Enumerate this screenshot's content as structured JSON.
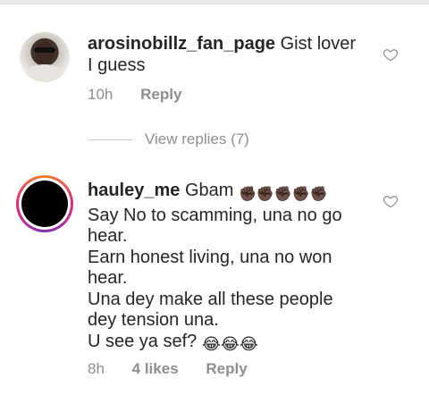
{
  "comments": [
    {
      "username": "arosinobillz_fan_page",
      "text": "Gist lover I guess",
      "time": "10h",
      "reply_label": "Reply",
      "view_replies": "View replies (7)"
    },
    {
      "username": "hauley_me",
      "text_line_1": "Gbam",
      "emoji_1": "✊🏿✊🏿✊🏿✊🏿✊🏿",
      "lines": [
        "Say No to scamming, una no go",
        "hear.",
        "Earn honest living, una no won",
        "hear.",
        "Una dey make all these people",
        "dey tension una.",
        "U see ya sef?"
      ],
      "emoji_2": "😂😂😂",
      "time": "8h",
      "likes": "4 likes",
      "reply_label": "Reply"
    }
  ],
  "colors": {
    "text": "#262626",
    "muted": "#8e8e8e",
    "ring_gradient": [
      "#f58529",
      "#dd2a7b",
      "#8134af"
    ]
  },
  "icons": [
    "heart-outline-icon",
    "heart-outline-icon"
  ]
}
